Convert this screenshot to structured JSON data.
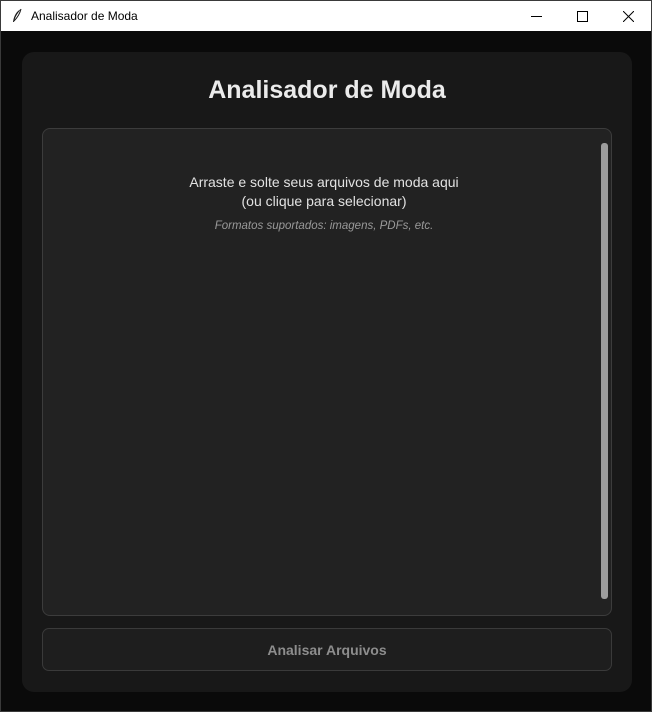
{
  "window": {
    "title": "Analisador de Moda",
    "controls": [
      "minimize-icon",
      "maximize-icon",
      "close-icon"
    ]
  },
  "main": {
    "heading": "Analisador de Moda",
    "dropzone": {
      "line1": "Arraste e solte seus arquivos de moda aqui",
      "line2": "(ou clique para selecionar)",
      "hint": "Formatos suportados: imagens, PDFs, etc."
    },
    "analyze_button": "Analisar Arquivos"
  },
  "colors": {
    "background": "#000000",
    "card": "#181818",
    "dropzone": "#222222",
    "heading": "#ebebeb",
    "button_text": "#8d8d8d"
  }
}
